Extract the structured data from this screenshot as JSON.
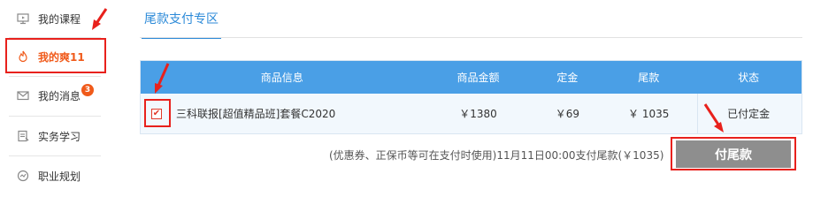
{
  "sidebar": {
    "items": [
      {
        "label": "我的课程",
        "icon": "monitor-icon"
      },
      {
        "label": "我的爽11",
        "icon": "flame-icon",
        "active": true
      },
      {
        "label": "我的消息",
        "icon": "mail-icon",
        "badge": "3"
      },
      {
        "label": "实务学习",
        "icon": "document-icon"
      },
      {
        "label": "职业规划",
        "icon": "clock-icon"
      }
    ]
  },
  "tabs": [
    {
      "label": "尾款支付专区",
      "active": true
    }
  ],
  "table": {
    "columns": [
      "商品信息",
      "商品金额",
      "定金",
      "尾款",
      "状态"
    ],
    "rows": [
      {
        "checked": true,
        "product": "三科联报[超值精品班]套餐C2020",
        "amount": "￥1380",
        "deposit": "￥69",
        "balance": "￥ 1035",
        "status": "已付定金"
      }
    ]
  },
  "footer": {
    "note": "(优惠券、正保币等可在支付时使用)11月11日00:00支付尾款(￥1035)",
    "pay_button": "付尾款"
  },
  "colors": {
    "accent": "#2c8ad8",
    "header_bg": "#4a9fe6",
    "active_orange": "#f05a1a",
    "highlight_red": "#e8211c",
    "button_gray": "#8e8e8e"
  }
}
